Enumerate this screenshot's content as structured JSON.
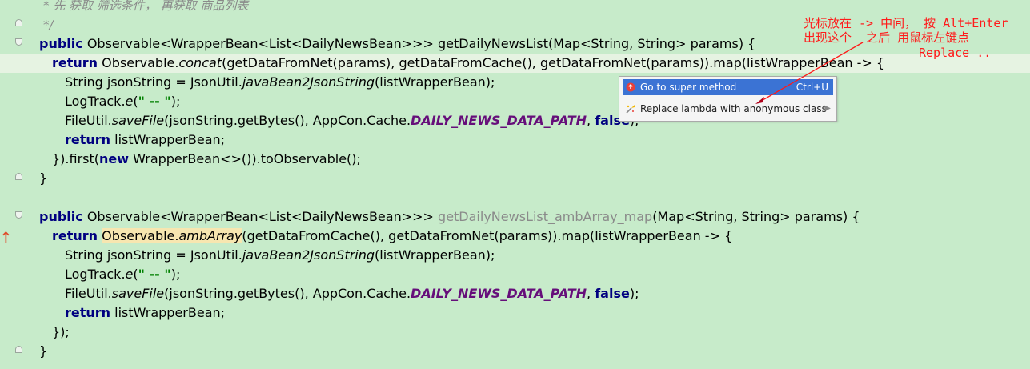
{
  "editor": {
    "lines": [
      {
        "segments": [
          {
            "text": "* 先 获取 筛选条件， 再获取 商品列表",
            "cls": "c-comment"
          }
        ]
      },
      {
        "segments": [
          {
            "text": "*/",
            "cls": "c-comment"
          }
        ]
      },
      {
        "segments": [
          {
            "text": "public",
            "cls": "c-kw"
          },
          {
            "text": " Observable<WrapperBean<List<DailyNewsBean>>> getDailyNewsList(Map<String, String> params) {",
            "cls": ""
          }
        ]
      },
      {
        "segments": [
          {
            "text": "return",
            "cls": "c-kw"
          },
          {
            "text": " Observable.",
            "cls": ""
          },
          {
            "text": "concat",
            "cls": "c-it"
          },
          {
            "text": "(getDataFromNet(params), getDataFromCache(), getDataFromNet(params)).map(listWrapperBean -> {",
            "cls": ""
          }
        ]
      },
      {
        "segments": [
          {
            "text": "String jsonString = JsonUtil.",
            "cls": ""
          },
          {
            "text": "javaBean2JsonString",
            "cls": "c-it"
          },
          {
            "text": "(listWrapperBean);",
            "cls": ""
          }
        ]
      },
      {
        "segments": [
          {
            "text": "LogTrack.",
            "cls": ""
          },
          {
            "text": "e",
            "cls": "c-it"
          },
          {
            "text": "(",
            "cls": ""
          },
          {
            "text": "\" -- \"",
            "cls": "c-str"
          },
          {
            "text": ");",
            "cls": ""
          }
        ]
      },
      {
        "segments": [
          {
            "text": "FileUtil.",
            "cls": ""
          },
          {
            "text": "saveFile",
            "cls": "c-it"
          },
          {
            "text": "(jsonString.getBytes(), AppCon.Cache.",
            "cls": ""
          },
          {
            "text": "DAILY_NEWS_DATA_PATH",
            "cls": "c-const"
          },
          {
            "text": ", ",
            "cls": ""
          },
          {
            "text": "false",
            "cls": "c-kw"
          },
          {
            "text": ");",
            "cls": ""
          }
        ]
      },
      {
        "segments": [
          {
            "text": "return",
            "cls": "c-kw"
          },
          {
            "text": " listWrapperBean;",
            "cls": ""
          }
        ]
      },
      {
        "segments": [
          {
            "text": "}).first(",
            "cls": ""
          },
          {
            "text": "new",
            "cls": "c-kw"
          },
          {
            "text": " WrapperBean<>()).toObservable();",
            "cls": ""
          }
        ]
      },
      {
        "segments": [
          {
            "text": "}",
            "cls": ""
          }
        ]
      },
      {
        "segments": []
      },
      {
        "segments": [
          {
            "text": "public",
            "cls": "c-kw"
          },
          {
            "text": " Observable<WrapperBean<List<DailyNewsBean>>> ",
            "cls": ""
          },
          {
            "text": "getDailyNewsList_ambArray_map",
            "cls": "c-gray"
          },
          {
            "text": "(Map<String, String> params) {",
            "cls": ""
          }
        ]
      },
      {
        "segments": [
          {
            "text": "return",
            "cls": "c-kw"
          },
          {
            "text": " ",
            "cls": ""
          },
          {
            "text": "Observable.",
            "cls": "c-warn"
          },
          {
            "text": "ambArray",
            "cls": "c-it c-warn"
          },
          {
            "text": "(getDataFromCache(), getDataFromNet(params)).map(listWrapperBean -> {",
            "cls": ""
          }
        ]
      },
      {
        "segments": [
          {
            "text": "String jsonString = JsonUtil.",
            "cls": ""
          },
          {
            "text": "javaBean2JsonString",
            "cls": "c-it"
          },
          {
            "text": "(listWrapperBean);",
            "cls": ""
          }
        ]
      },
      {
        "segments": [
          {
            "text": "LogTrack.",
            "cls": ""
          },
          {
            "text": "e",
            "cls": "c-it"
          },
          {
            "text": "(",
            "cls": ""
          },
          {
            "text": "\" -- \"",
            "cls": "c-str"
          },
          {
            "text": ");",
            "cls": ""
          }
        ]
      },
      {
        "segments": [
          {
            "text": "FileUtil.",
            "cls": ""
          },
          {
            "text": "saveFile",
            "cls": "c-it"
          },
          {
            "text": "(jsonString.getBytes(), AppCon.Cache.",
            "cls": ""
          },
          {
            "text": "DAILY_NEWS_DATA_PATH",
            "cls": "c-const"
          },
          {
            "text": ", ",
            "cls": ""
          },
          {
            "text": "false",
            "cls": "c-kw"
          },
          {
            "text": ");",
            "cls": ""
          }
        ]
      },
      {
        "segments": [
          {
            "text": "return",
            "cls": "c-kw"
          },
          {
            "text": " listWrapperBean;",
            "cls": ""
          }
        ]
      },
      {
        "segments": [
          {
            "text": "});",
            "cls": ""
          }
        ]
      },
      {
        "segments": [
          {
            "text": "}",
            "cls": ""
          }
        ]
      }
    ]
  },
  "intention_popup": {
    "items": [
      {
        "label": "Go to super method",
        "shortcut": "Ctrl+U",
        "icon": "super-method-icon"
      },
      {
        "label": "Replace lambda with anonymous class",
        "shortcut": "",
        "icon": "intention-bulb-icon"
      }
    ]
  },
  "annotation": {
    "line1": "光标放在 -> 中间， 按 Alt+Enter",
    "line2": "出现这个  之后 用鼠标左键点",
    "line3": "Replace .."
  },
  "colors": {
    "background": "#c7ebca",
    "current_line": "#e6f3e2",
    "selection": "#3b73d4",
    "annotation": "#ff1a1a"
  }
}
